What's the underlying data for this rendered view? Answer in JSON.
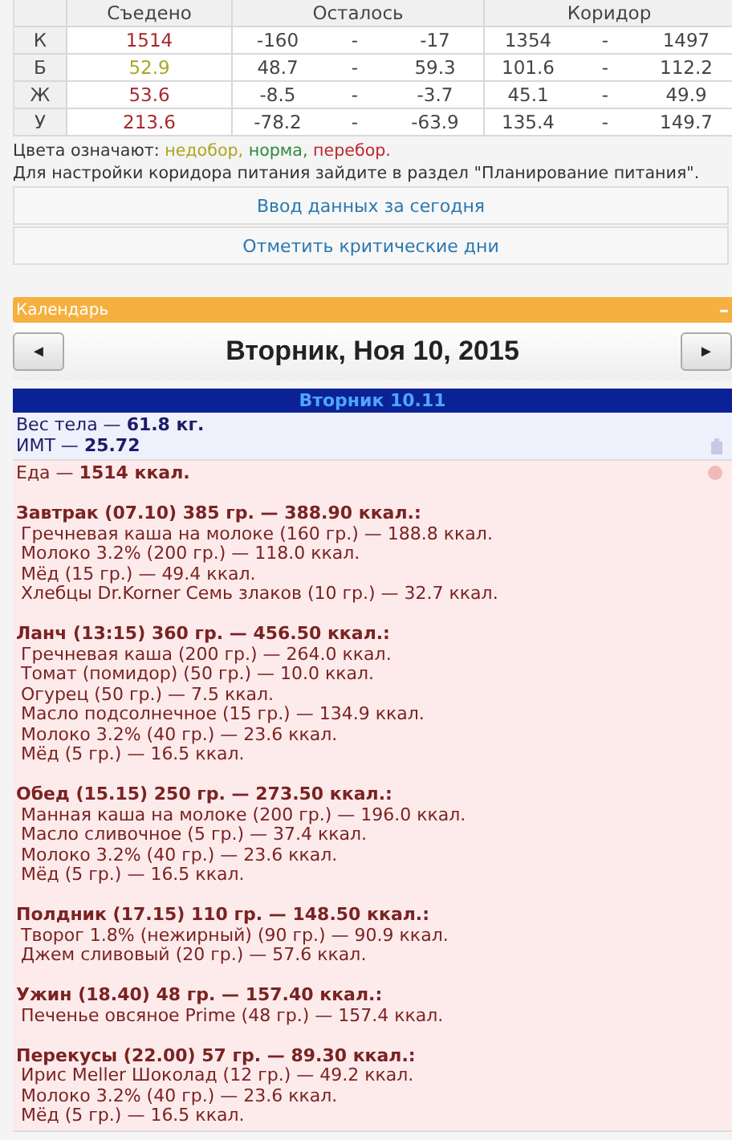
{
  "table": {
    "columns": [
      "Съедено",
      "Осталось",
      "Коридор"
    ],
    "rows": [
      {
        "label": "К",
        "eaten": "1514",
        "color": "#a8282c",
        "left_from": "-160",
        "left_to": "-17",
        "range_from": "1354",
        "range_to": "1497"
      },
      {
        "label": "Б",
        "eaten": "52.9",
        "color": "#a9a81e",
        "left_from": "48.7",
        "left_to": "59.3",
        "range_from": "101.6",
        "range_to": "112.2"
      },
      {
        "label": "Ж",
        "eaten": "53.6",
        "color": "#a8282c",
        "left_from": "-8.5",
        "left_to": "-3.7",
        "range_from": "45.1",
        "range_to": "49.9"
      },
      {
        "label": "У",
        "eaten": "213.6",
        "color": "#a8282c",
        "left_from": "-78.2",
        "left_to": "-63.9",
        "range_from": "135.4",
        "range_to": "149.7"
      }
    ],
    "separator": "-"
  },
  "legend": {
    "label": "Цвета означают:",
    "items": [
      {
        "text": "недобор,",
        "color": "#a9a81e"
      },
      {
        "text": "норма,",
        "color": "#2e8b3a"
      },
      {
        "text": "перебор.",
        "color": "#c0282c"
      }
    ]
  },
  "note": "Для настройки коридора питания зайдите в раздел \"Планирование питания\".",
  "buttons": [
    "Ввод данных за сегодня",
    "Отметить критические дни"
  ],
  "calendar": {
    "title": "Календарь",
    "collapse": "–",
    "prev": "◄",
    "next": "►",
    "date": "Вторник, Ноя 10, 2015",
    "day_label": "Вторник 10.11",
    "body": [
      {
        "kind": "weight",
        "lines": [
          "Вес тела — **61.8 кг.**",
          "ИМТ — **25.72**"
        ]
      }
    ],
    "food": {
      "total": "Еда — **1514 ккал.**",
      "meals": [
        {
          "title": "Завтрак (07.10) 385 гр. — 388.90 ккал.:",
          "items": [
            "Гречневая каша на молоке (160 гр.) — 188.8 ккал.",
            "Молоко 3.2% (200 гр.) — 118.0 ккал.",
            "Мёд (15 гр.) — 49.4 ккал.",
            "Хлебцы Dr.Korner Семь злаков (10 гр.) — 32.7 ккал."
          ]
        },
        {
          "title": "Ланч (13:15) 360 гр. — 456.50 ккал.:",
          "items": [
            "Гречневая каша (200 гр.) — 264.0 ккал.",
            "Томат (помидор) (50 гр.) — 10.0 ккал.",
            "Огурец (50 гр.) — 7.5 ккал.",
            "Масло подсолнечное (15 гр.) — 134.9 ккал.",
            "Молоко 3.2% (40 гр.) — 23.6 ккал.",
            "Мёд (5 гр.) — 16.5 ккал."
          ]
        },
        {
          "title": "Обед (15.15) 250 гр. — 273.50 ккал.:",
          "items": [
            "Манная каша на молоке (200 гр.) — 196.0 ккал.",
            "Масло сливочное (5 гр.) — 37.4 ккал.",
            "Молоко 3.2% (40 гр.) — 23.6 ккал.",
            "Мёд (5 гр.) — 16.5 ккал."
          ]
        },
        {
          "title": "Полдник (17.15) 110 гр. — 148.50 ккал.:",
          "items": [
            "Творог 1.8% (нежирный) (90 гр.) — 90.9 ккал.",
            "Джем сливовый (20 гр.) — 57.6 ккал."
          ]
        },
        {
          "title": "Ужин (18.40) 48 гр. — 157.40 ккал.:",
          "items": [
            "Печенье овсяное Prime (48 гр.) — 157.4 ккал."
          ]
        },
        {
          "title": "Перекусы (22.00) 57 гр. — 89.30 ккал.:",
          "items": [
            "Ирис Meller Шоколад (12 гр.) — 49.2 ккал.",
            "Молоко 3.2% (40 гр.) — 23.6 ккал.",
            "Мёд (5 гр.) — 16.5 ккал."
          ]
        }
      ]
    }
  }
}
